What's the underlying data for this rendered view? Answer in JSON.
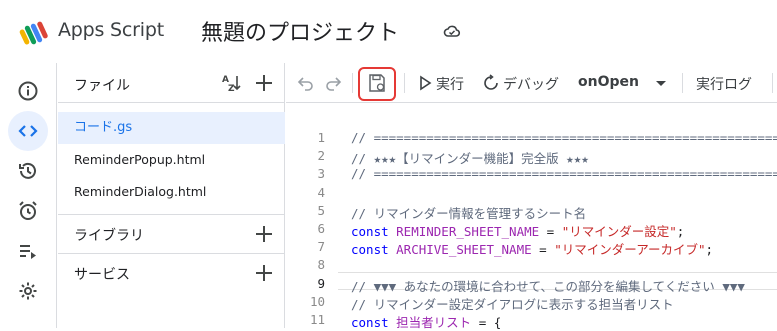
{
  "header": {
    "app_name": "Apps Script",
    "project_title": "無題のプロジェクト"
  },
  "rail": {
    "items": [
      {
        "icon": "info-icon"
      },
      {
        "icon": "code-icon",
        "active": true
      },
      {
        "icon": "history-icon"
      },
      {
        "icon": "alarm-icon"
      },
      {
        "icon": "executions-icon"
      },
      {
        "icon": "settings-icon"
      }
    ]
  },
  "files": {
    "title": "ファイル",
    "items": [
      {
        "name": "コード.gs",
        "active": true
      },
      {
        "name": "ReminderPopup.html"
      },
      {
        "name": "ReminderDialog.html"
      }
    ],
    "libraries_label": "ライブラリ",
    "services_label": "サービス"
  },
  "toolbar": {
    "run_label": "実行",
    "debug_label": "デバッグ",
    "function_select": "onOpen",
    "log_label": "実行ログ"
  },
  "editor": {
    "lines": [
      {
        "n": "1",
        "text": "// =========================================================="
      },
      {
        "n": "2",
        "text": "// ★★★【リマインダー機能】完全版 ★★★"
      },
      {
        "n": "3",
        "text": "// =========================================================="
      },
      {
        "n": "4",
        "text": ""
      },
      {
        "n": "5",
        "text": "// リマインダー情報を管理するシート名"
      },
      {
        "n": "6",
        "kw": "const ",
        "var": "REMINDER_SHEET_NAME",
        "op": " = ",
        "str": "\"リマインダー設定\"",
        "end": ";"
      },
      {
        "n": "7",
        "kw": "const ",
        "var": "ARCHIVE_SHEET_NAME",
        "op": " = ",
        "str": "\"リマインダーアーカイブ\"",
        "end": ";"
      },
      {
        "n": "8",
        "text": ""
      },
      {
        "n": "9",
        "text": "// ▼▼▼ あなたの環境に合わせて、この部分を編集してください ▼▼▼"
      },
      {
        "n": "10",
        "text": "// リマインダー設定ダイアログに表示する担当者リスト"
      },
      {
        "n": "11",
        "kw": "const ",
        "var": "担当者リスト",
        "op": " = {",
        "str": "",
        "end": ""
      }
    ]
  },
  "colors": {
    "accent": "#1a73e8",
    "active_bg": "#e8f0fe",
    "highlight": "#e53935",
    "keyword": "#0000ff",
    "variable": "#9c27b0",
    "string": "#c62828",
    "comment": "#5f6a7d"
  }
}
